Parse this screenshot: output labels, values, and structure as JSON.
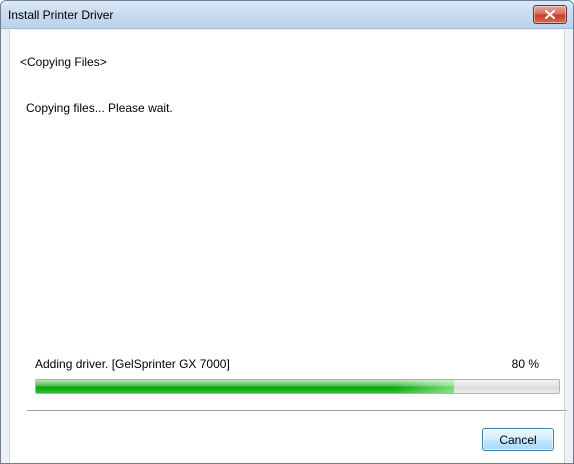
{
  "window": {
    "title": "Install Printer Driver",
    "close_icon": "close-icon"
  },
  "content": {
    "step_heading": "<Copying Files>",
    "status_message": "Copying files... Please wait."
  },
  "progress": {
    "task_label": "Adding driver. [GelSprinter GX 7000]",
    "percent_text": "80 %",
    "fraction": 0.8
  },
  "buttons": {
    "cancel_label": "Cancel"
  },
  "colors": {
    "progress_green": "#08a50a",
    "close_red": "#c2412b",
    "button_border": "#3c7fb1"
  }
}
